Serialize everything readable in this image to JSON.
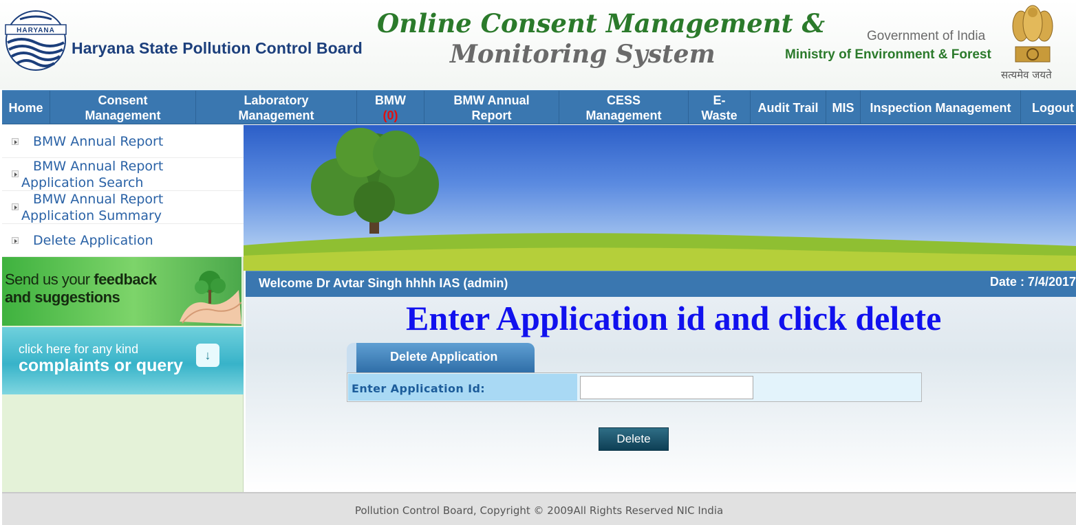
{
  "header": {
    "logo_text": "HARYANA",
    "org_name": "Haryana State Pollution Control Board",
    "app_title_line1": "Online Consent Management &",
    "app_title_line2": "Monitoring System",
    "gov_text": "Government of India",
    "ministry_text": "Ministry of Environment & Forest",
    "motto": "सत्यमेव जयते"
  },
  "nav": {
    "home": "Home",
    "consent_line1": "Consent",
    "consent_line2": "Management",
    "lab_line1": "Laboratory",
    "lab_line2": "Management",
    "bmw": "BMW",
    "bmw_count": "(0)",
    "bmw_annual_line1": "BMW Annual",
    "bmw_annual_line2": "Report",
    "cess_line1": "CESS",
    "cess_line2": "Management",
    "ewaste_line1": "E-",
    "ewaste_line2": "Waste",
    "audit": "Audit Trail",
    "mis": "MIS",
    "inspection": "Inspection Management",
    "logout": "Logout"
  },
  "sidebar": {
    "items": [
      {
        "label": "BMW Annual Report"
      },
      {
        "label": "BMW Annual Report Application Search"
      },
      {
        "label": "BMW Annual Report Application Summary"
      },
      {
        "label": "Delete Application"
      }
    ],
    "feedback_prefix_1": "Send us your ",
    "feedback_bold_1": "feedback",
    "feedback_bold_2": "and suggestions",
    "complaint_small": "click here for any kind",
    "complaint_big": "complaints or query",
    "complaint_arrow": "↓"
  },
  "welcome": {
    "text": "Welcome Dr Avtar Singh hhhh IAS (admin)",
    "date": "Date : 7/4/2017"
  },
  "main": {
    "instruction": "Enter Application id and click delete",
    "panel_title": "Delete Application",
    "field_label": "Enter Application Id:",
    "field_value": "",
    "delete_button": "Delete"
  },
  "footer": {
    "text": "Pollution Control Board, Copyright © 2009All Rights Reserved NIC India"
  }
}
